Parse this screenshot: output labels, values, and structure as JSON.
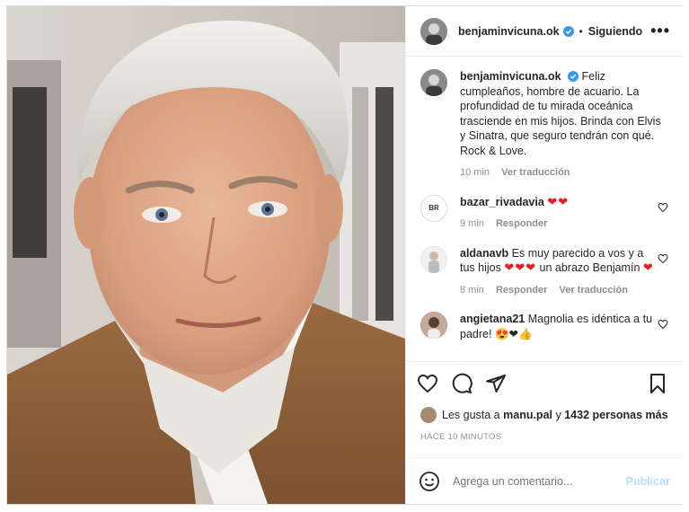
{
  "post": {
    "author": "benjaminvicuna.ok",
    "follow_dot": "•",
    "follow_status": "Siguiendo",
    "more": "•••"
  },
  "caption": {
    "user": "benjaminvicuna.ok",
    "text": "Feliz cumpleaños, hombre de acuario. La profundidad de tu mirada oceánica trasciende en mis hijos. Brinda con Elvis y Sinatra, que seguro tendrán con qué. Rock & Love.",
    "time": "10 min",
    "translate": "Ver traducción"
  },
  "comments": [
    {
      "user": "bazar_rivadavia",
      "avatar_text": "BR",
      "text": "",
      "emoji": "❤❤",
      "time": "9 min",
      "reply": "Responder",
      "translate": ""
    },
    {
      "user": "aldanavb",
      "text": "Es muy parecido a vos y a tus hijos",
      "emoji": "❤❤❤",
      "text2": "un abrazo Benjamín",
      "emoji2": "❤",
      "time": "8 min",
      "reply": "Responder",
      "translate": "Ver traducción"
    },
    {
      "user": "angietana21",
      "text": "Magnolia es idéntica a tu padre!",
      "emoji": "😍❤👍",
      "time": "",
      "reply": "",
      "translate": ""
    }
  ],
  "likes": {
    "prefix": "Les gusta a",
    "user": "manu.pal",
    "connector": "y",
    "others": "1432 personas más"
  },
  "timestamp": "HACE 10 MINUTOS",
  "add_comment": {
    "placeholder": "Agrega un comentario...",
    "publish": "Publicar"
  },
  "colors": {
    "verified": "#3897f0",
    "heart": "#ed1c24",
    "publish": "#b2dffc",
    "muted": "#8e8e8e"
  }
}
